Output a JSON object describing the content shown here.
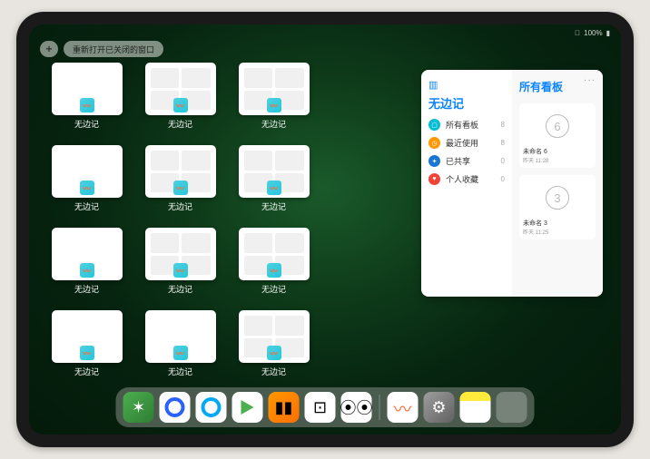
{
  "status": {
    "battery": "100%",
    "wifi": "▲"
  },
  "topbar": {
    "plus": "+",
    "reopen_label": "重新打开已关闭的窗口"
  },
  "thumbs": {
    "label": "无边记",
    "layout": [
      "blank",
      "grid",
      "grid",
      "none",
      "blank",
      "grid",
      "grid",
      "none",
      "blank",
      "grid",
      "grid",
      "none",
      "blank",
      "blank",
      "grid",
      "none"
    ]
  },
  "panel": {
    "dots": "···",
    "left_title": "无边记",
    "menu": [
      {
        "label": "所有看板",
        "count": 8,
        "color": "#00bcd4",
        "glyph": "▢"
      },
      {
        "label": "最近使用",
        "count": 8,
        "color": "#ff9800",
        "glyph": "◷"
      },
      {
        "label": "已共享",
        "count": 0,
        "color": "#1976d2",
        "glyph": "✦"
      },
      {
        "label": "个人收藏",
        "count": 0,
        "color": "#f44336",
        "glyph": "♥"
      }
    ],
    "right_title": "所有看板",
    "boards": [
      {
        "digit": "6",
        "name": "未命名 6",
        "date": "昨天 11:28"
      },
      {
        "digit": "3",
        "name": "未命名 3",
        "date": "昨天 11:25"
      }
    ]
  },
  "dock": {
    "apps": [
      {
        "id": "wechat",
        "name": "WeChat"
      },
      {
        "id": "quark",
        "name": "Quark"
      },
      {
        "id": "qq",
        "name": "QQ Browser"
      },
      {
        "id": "play",
        "name": "Play"
      },
      {
        "id": "books",
        "name": "Books"
      },
      {
        "id": "game",
        "name": "Game"
      },
      {
        "id": "grid",
        "name": "Grid App"
      }
    ],
    "recent": [
      {
        "id": "freeform",
        "name": "Freeform"
      },
      {
        "id": "settings",
        "name": "Settings"
      },
      {
        "id": "notes",
        "name": "Notes"
      },
      {
        "id": "folder",
        "name": "App Folder"
      }
    ]
  }
}
